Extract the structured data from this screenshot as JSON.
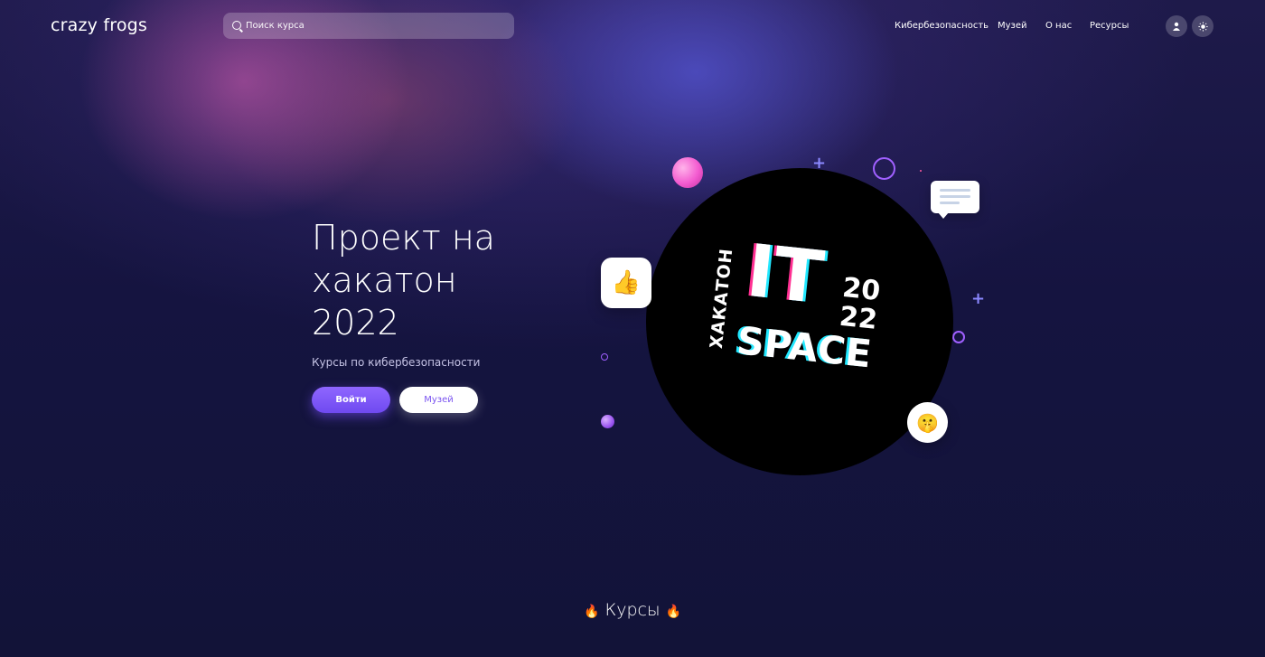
{
  "header": {
    "logo": "crazy frogs",
    "search_placeholder": "Поиск курса",
    "nav": [
      "Кибербезопасность",
      "Музей",
      "О нас",
      "Ресурсы"
    ]
  },
  "hero": {
    "title_lines": [
      "Проект на",
      "хакатон",
      "2022"
    ],
    "subtitle": "Курсы по кибербезопасности",
    "login_label": "Войти",
    "museum_label": "Музей"
  },
  "badge": {
    "side": "ХАКАТОН",
    "main": "IT",
    "year_top": "20",
    "year_bottom": "22",
    "bottom": "SPACE"
  },
  "emoji": {
    "thumb": "👍",
    "wink": "🤫",
    "fire": "🔥"
  },
  "section_title": "Курсы",
  "colors": {
    "accent": "#7b55f0",
    "background": "#12133a",
    "pink": "#f35bd0"
  },
  "icons": [
    "search-icon",
    "user-icon",
    "sun-icon"
  ]
}
